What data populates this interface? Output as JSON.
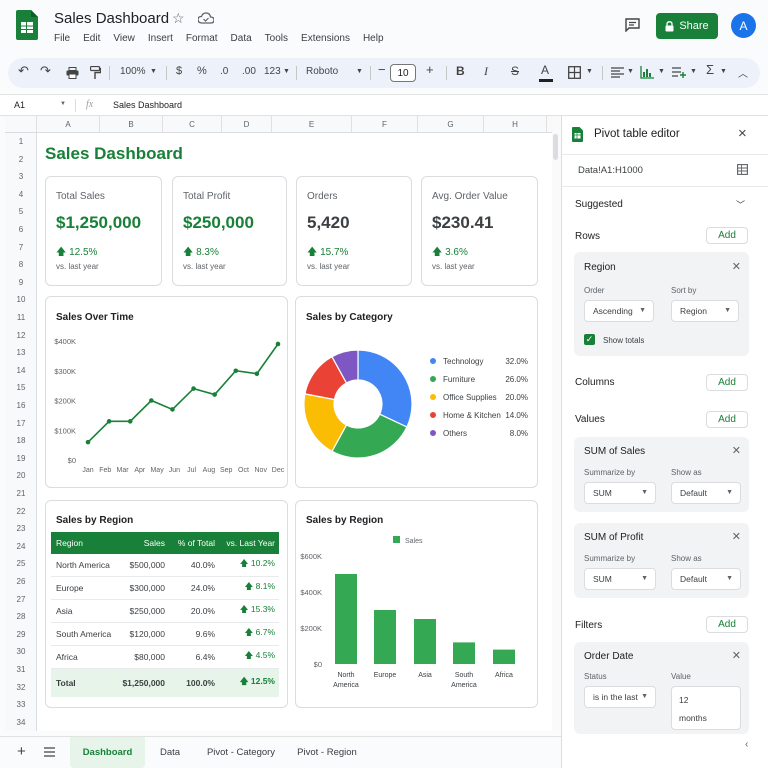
{
  "window": {
    "title": "Sales Dashboard",
    "menus": [
      "File",
      "Edit",
      "View",
      "Insert",
      "Format",
      "Data",
      "Tools",
      "Extensions",
      "Help"
    ],
    "share_label": "Share",
    "avatar_letter": "A"
  },
  "toolbar": {
    "zoom": "100%",
    "currency": "$",
    "percent": "%",
    "decimal_decrease": ".0",
    "decimal_increase": ".00",
    "number_format": "123",
    "font": "Roboto",
    "font_size": "10",
    "bold": "B",
    "italic": "I",
    "text_color_letter": "A"
  },
  "formula_bar": {
    "cell_ref": "A1",
    "fx": "fx",
    "content": "Sales Dashboard"
  },
  "grid": {
    "columns": [
      "A",
      "B",
      "C",
      "D",
      "E",
      "F",
      "G",
      "H"
    ],
    "rows": [
      "1",
      "2",
      "3",
      "4",
      "5",
      "6",
      "7",
      "8",
      "9",
      "10",
      "11",
      "12",
      "13",
      "14",
      "15",
      "16",
      "17",
      "18",
      "19",
      "20",
      "21",
      "22",
      "23",
      "24",
      "25",
      "26",
      "27",
      "28",
      "29",
      "30",
      "31",
      "32",
      "33",
      "34"
    ]
  },
  "dashboard": {
    "title": "Sales Dashboard",
    "kpis": [
      {
        "label": "Total Sales",
        "value": "$1,250,000",
        "change": "12.5%",
        "sub": "vs. last year"
      },
      {
        "label": "Total Profit",
        "value": "$250,000",
        "change": "8.3%",
        "sub": "vs. last year"
      },
      {
        "label": "Orders",
        "value": "5,420",
        "change": "15.7%",
        "sub": "vs. last year"
      },
      {
        "label": "Avg. Order Value",
        "value": "$230.41",
        "change": "3.6%",
        "sub": "vs. last year"
      }
    ],
    "region_table": {
      "title": "Sales by Region",
      "headers": [
        "Region",
        "Sales",
        "% of Total",
        "vs. Last Year"
      ],
      "rows": [
        [
          "North America",
          "$500,000",
          "40.0%",
          "10.2%"
        ],
        [
          "Europe",
          "$300,000",
          "24.0%",
          "8.1%"
        ],
        [
          "Asia",
          "$250,000",
          "20.0%",
          "15.3%"
        ],
        [
          "South America",
          "$120,000",
          "9.6%",
          "6.7%"
        ],
        [
          "Africa",
          "$80,000",
          "6.4%",
          "4.5%"
        ]
      ],
      "total": [
        "Total",
        "$1,250,000",
        "100.0%",
        "12.5%"
      ]
    }
  },
  "colors": {
    "accent": "#188038",
    "blue": "#4285f4",
    "green": "#34a853",
    "yellow": "#fbbc04",
    "red": "#ea4335",
    "purple": "#7e57c2"
  },
  "chart_data": [
    {
      "type": "line",
      "title": "Sales Over Time",
      "categories": [
        "Jan",
        "Feb",
        "Mar",
        "Apr",
        "May",
        "Jun",
        "Jul",
        "Aug",
        "Sep",
        "Oct",
        "Nov",
        "Dec"
      ],
      "values": [
        60,
        130,
        130,
        200,
        170,
        240,
        220,
        300,
        290,
        390
      ],
      "x_index": [
        0,
        1,
        2,
        3,
        4,
        5,
        6,
        7,
        8,
        9
      ],
      "yticks": [
        "$0",
        "$100K",
        "$200K",
        "$300K",
        "$400K"
      ],
      "ylim": [
        0,
        400
      ]
    },
    {
      "type": "pie",
      "title": "Sales by Category",
      "labels": [
        "Technology",
        "Furniture",
        "Office Supplies",
        "Home & Kitchen",
        "Others"
      ],
      "values": [
        32.0,
        26.0,
        20.0,
        14.0,
        8.0
      ],
      "value_labels": [
        "32.0%",
        "26.0%",
        "20.0%",
        "14.0%",
        "8.0%"
      ],
      "legend": "right"
    },
    {
      "type": "bar",
      "title": "Sales by Region",
      "categories": [
        [
          "North",
          "America"
        ],
        [
          "Europe"
        ],
        [
          "Asia"
        ],
        [
          "South",
          "America"
        ],
        [
          "Africa"
        ]
      ],
      "series": [
        {
          "name": "Sales",
          "values": [
            500,
            300,
            250,
            120,
            80
          ]
        }
      ],
      "yticks": [
        "$0",
        "$200K",
        "$400K",
        "$600K"
      ],
      "ylim": [
        0,
        600
      ],
      "legend": "top"
    }
  ],
  "pivot": {
    "title": "Pivot table editor",
    "range": "Data!A1:H1000",
    "suggested": "Suggested",
    "rows_label": "Rows",
    "columns_label": "Columns",
    "values_label": "Values",
    "filters_label": "Filters",
    "add": "Add",
    "row_field": {
      "name": "Region",
      "order_label": "Order",
      "order": "Ascending",
      "sort_label": "Sort by",
      "sort": "Region",
      "show_totals": "Show totals"
    },
    "values": [
      {
        "name": "SUM of Sales",
        "summarize_label": "Summarize by",
        "summarize": "SUM",
        "show_label": "Show as",
        "show": "Default"
      },
      {
        "name": "SUM of Profit",
        "summarize_label": "Summarize by",
        "summarize": "SUM",
        "show_label": "Show as",
        "show": "Default"
      }
    ],
    "filter": {
      "name": "Order Date",
      "status_label": "Status",
      "status": "is in the last",
      "value_label": "Value",
      "value_line1": "12",
      "value_line2": "months"
    }
  },
  "sheets": [
    "Dashboard",
    "Data",
    "Pivot - Category",
    "Pivot - Region"
  ]
}
